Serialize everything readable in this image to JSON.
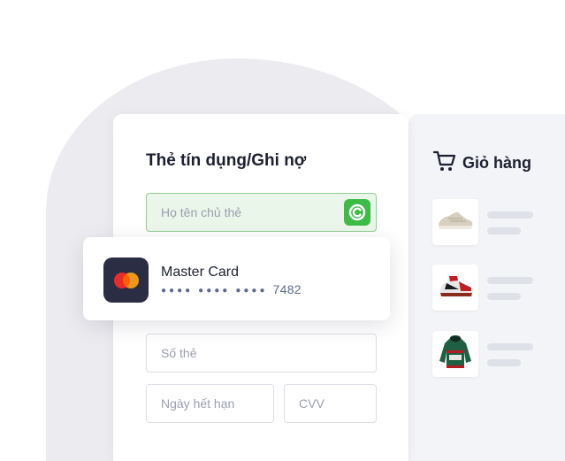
{
  "form": {
    "title": "Thẻ tín dụng/Ghi nợ",
    "name_placeholder": "Họ tên chủ thẻ",
    "card_number_placeholder": "Số thẻ",
    "expiry_placeholder": "Ngày hết hạn",
    "cvv_placeholder": "CVV",
    "autofill_icon": "autofill-icon"
  },
  "saved_card": {
    "brand": "Master Card",
    "masked_groups": [
      "●●●●",
      "●●●●",
      "●●●●"
    ],
    "last_digits": "7482",
    "logo_icon": "mastercard-logo"
  },
  "cart": {
    "title": "Giỏ hàng",
    "icon": "shopping-cart-icon",
    "items": [
      {
        "icon": "sneaker-beige-icon"
      },
      {
        "icon": "sneaker-red-black-icon"
      },
      {
        "icon": "hoodie-icon"
      }
    ]
  },
  "colors": {
    "accent_green": "#3cbb46",
    "field_highlight": "#eaf6ea",
    "card_dark": "#2b2d45",
    "mastercard_red": "#eb2a2a",
    "mastercard_orange": "#f79e1b"
  }
}
